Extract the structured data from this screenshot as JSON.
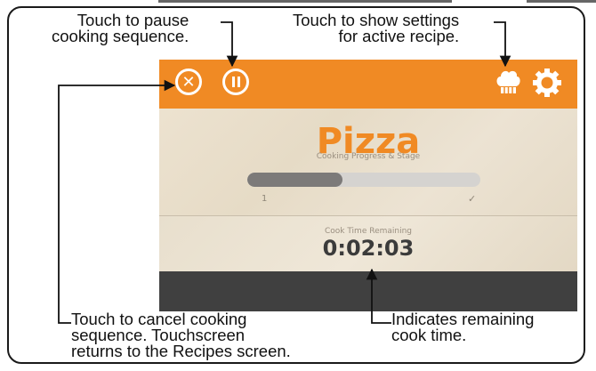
{
  "callouts": {
    "pause": "Touch to pause\ncooking sequence.",
    "settings": "Touch to show settings\nfor active recipe.",
    "cancel": "Touch to cancel cooking\nsequence. Touchscreen\nreturns to the Recipes screen.",
    "time": "Indicates remaining\ncook time."
  },
  "screen": {
    "recipe_name": "Pizza",
    "progress_label": "Cooking Progress & Stage",
    "progress_fraction": 0.41,
    "stage_start": "1",
    "stage_end": "✓",
    "timer_label": "Cook Time Remaining",
    "timer_value": "0:02:03"
  },
  "icons": {
    "cancel": "close-icon",
    "pause": "pause-icon",
    "recipe_settings": "chef-hat-icon",
    "settings": "gear-icon"
  },
  "colors": {
    "accent": "#f08a24",
    "bottom_bar": "#404040"
  }
}
